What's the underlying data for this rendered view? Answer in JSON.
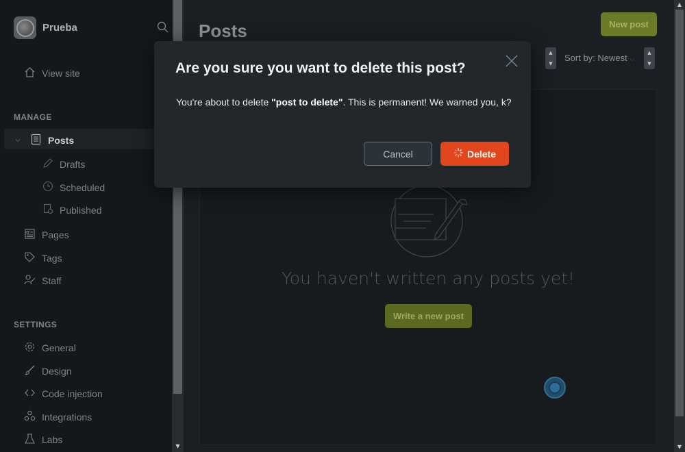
{
  "sidebar": {
    "brand": "Prueba",
    "view_site": "View site",
    "manage_heading": "MANAGE",
    "posts": "Posts",
    "drafts": "Drafts",
    "scheduled": "Scheduled",
    "published": "Published",
    "pages": "Pages",
    "tags": "Tags",
    "staff": "Staff",
    "settings_heading": "SETTINGS",
    "general": "General",
    "design": "Design",
    "code_injection": "Code injection",
    "integrations": "Integrations",
    "labs": "Labs"
  },
  "main": {
    "title": "Posts",
    "new_post": "New post",
    "sort_label": "Sort by: Newest",
    "empty_message": "You haven't written any posts yet!",
    "write_button": "Write a new post"
  },
  "modal": {
    "title": "Are you sure you want to delete this post?",
    "body_prefix": "You're about to delete ",
    "post_name": "\"post to delete\"",
    "body_suffix": ". This is permanent! We warned you, k?",
    "cancel": "Cancel",
    "delete": "Delete"
  },
  "colors": {
    "accent_green": "#6a7a25",
    "danger": "#e2461c",
    "sidebar_bg": "#15181b",
    "main_bg": "#1b1f23",
    "modal_bg": "#22272c"
  },
  "icons": [
    "search-icon",
    "home-icon",
    "posts-icon",
    "pencil-icon",
    "clock-icon",
    "published-icon",
    "pages-icon",
    "tag-icon",
    "staff-icon",
    "gear-icon",
    "brush-icon",
    "code-icon",
    "integrations-icon",
    "flask-icon",
    "close-icon",
    "spinner-icon"
  ]
}
